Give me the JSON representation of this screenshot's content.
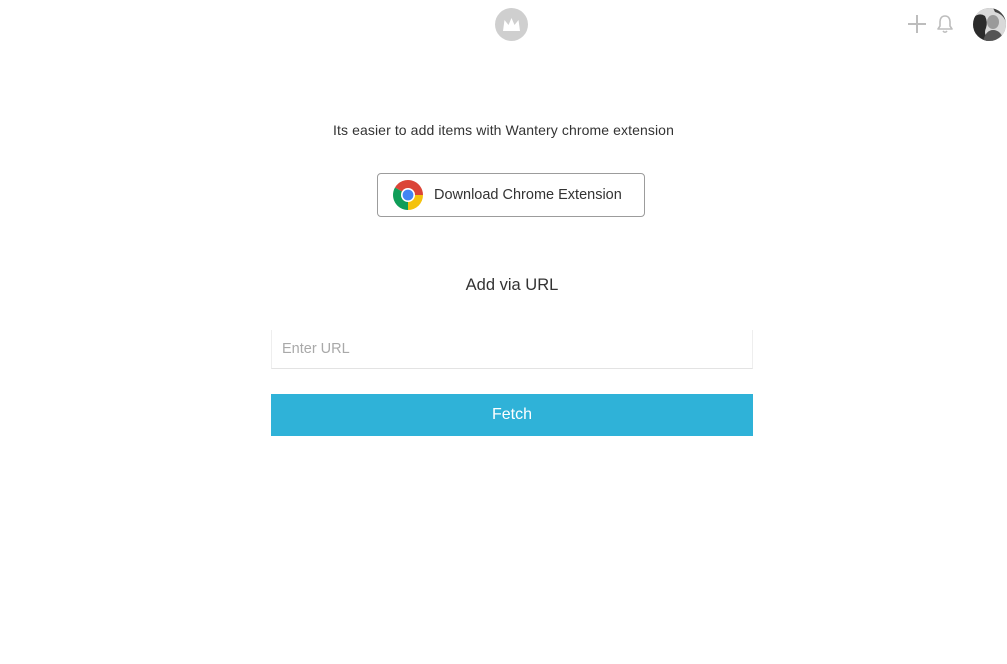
{
  "header": {
    "logo_icon": "crown-logo-icon",
    "add_icon": "plus-icon",
    "notifications_icon": "bell-icon",
    "avatar": "user-avatar"
  },
  "main": {
    "intro_text": "Its easier to add items with Wantery chrome extension",
    "chrome_button": {
      "icon": "chrome-icon",
      "label": "Download Chrome Extension"
    },
    "section_title": "Add via URL",
    "url_input": {
      "placeholder": "Enter URL",
      "value": ""
    },
    "fetch_button_label": "Fetch"
  },
  "colors": {
    "accent": "#2fb2d8",
    "logo_gray": "#cfcfcf",
    "icon_gray": "#bdbdbd",
    "text": "#333333"
  }
}
